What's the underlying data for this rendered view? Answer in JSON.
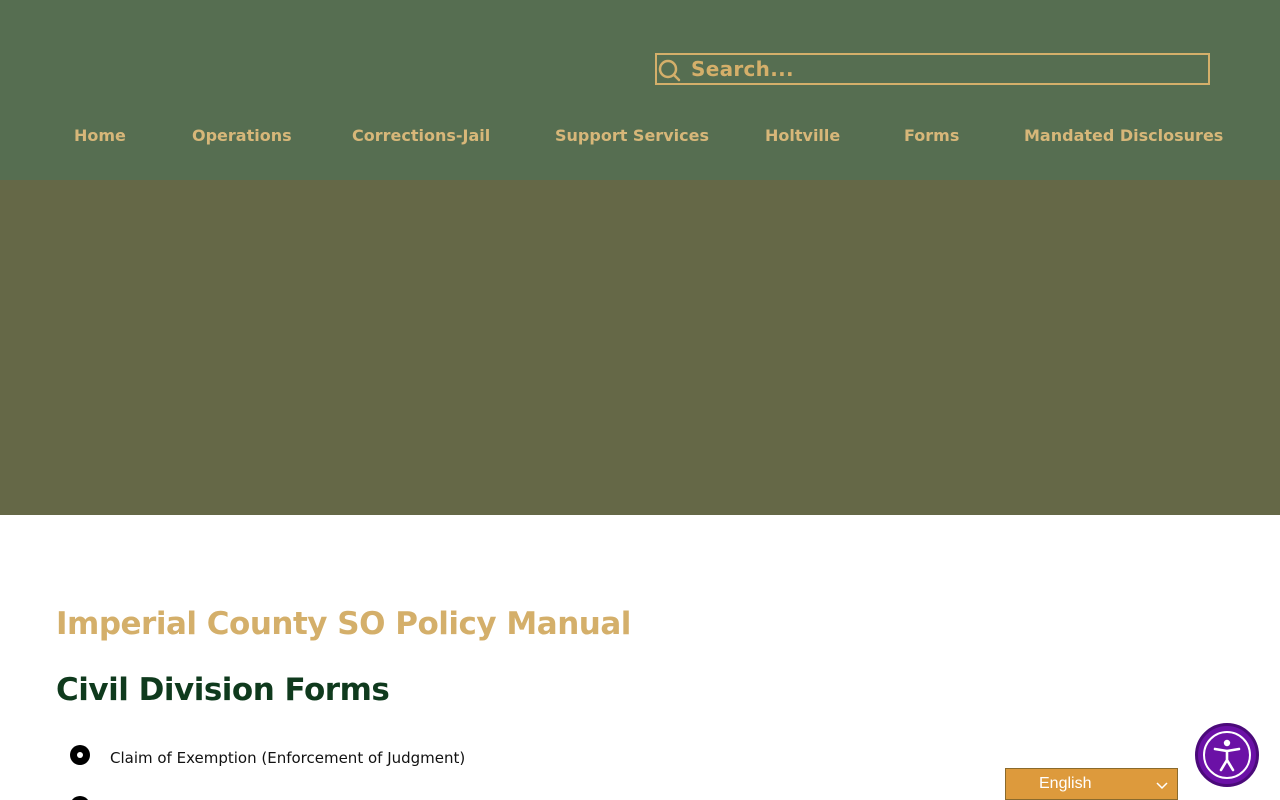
{
  "search": {
    "placeholder": "Search...",
    "icon": "search-icon"
  },
  "nav": {
    "items": [
      {
        "label": "Home"
      },
      {
        "label": "Operations"
      },
      {
        "label": "Corrections-Jail"
      },
      {
        "label": "Support Services"
      },
      {
        "label": "Holtville"
      },
      {
        "label": "Forms"
      },
      {
        "label": "Mandated Disclosures"
      }
    ]
  },
  "main": {
    "manual_title": "Imperial County SO Policy Manual",
    "section_title": "Civil Division Forms",
    "forms": [
      {
        "label": "Claim of Exemption (Enforcement of Judgment)"
      }
    ]
  },
  "language": {
    "selected": "English"
  },
  "accessibility": {
    "icon": "accessibility-icon"
  },
  "colors": {
    "header_bg": "#566e51",
    "hero_bg": "#656847",
    "accent_gold": "#d4af6a",
    "section_title": "#0f3a1d",
    "language_bg": "#dd9a3c",
    "accessibility_bg": "#6b11a6"
  }
}
